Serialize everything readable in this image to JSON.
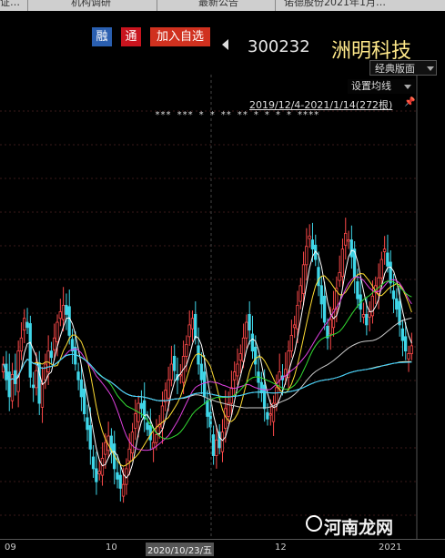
{
  "tabs": [
    "证…",
    "机构调研",
    "最新公告",
    "诺德股份2021年1月…"
  ],
  "header": {
    "badges": [
      {
        "label": "融",
        "color": "#2a5fb0"
      },
      {
        "label": "通",
        "color": "#c8141e"
      },
      {
        "label": "加入自选",
        "color": "#d0311f"
      }
    ],
    "stock_code": "300232",
    "stock_name": "洲明科技"
  },
  "toolbar": {
    "style_label": "经典版面",
    "ma_label": "设置均线",
    "range_label": "2019/12/4-2021/1/14(272根)"
  },
  "markers_text": "***  ***   *    *      **  **        *   *   *   *  ****",
  "x_axis": {
    "labels": [
      "09",
      "10",
      "2020/10/23/五",
      "12",
      "2021"
    ]
  },
  "colors": {
    "up": "#ff4a4a",
    "down": "#3fd6e8",
    "ma5": "#ffffff",
    "ma10": "#ffdd33",
    "ma20": "#e040e0",
    "ma30": "#33dd33",
    "ma60": "#cccccc",
    "ma120": "#ffffcc",
    "ma250": "#33ccff"
  },
  "chart_data": {
    "type": "candlestick",
    "series": [
      {
        "name": "close",
        "values": [
          410,
          398,
          385,
          402,
          395,
          420,
          430,
          445,
          438,
          400,
          392,
          405,
          380,
          395,
          410,
          420,
          415,
          430,
          442,
          450,
          455,
          448,
          432,
          420,
          410,
          398,
          385,
          372,
          360,
          345,
          330,
          320,
          328,
          338,
          350,
          355,
          343,
          330,
          322,
          315,
          318,
          330,
          345,
          358,
          372,
          380,
          376,
          368,
          360,
          352,
          350,
          356,
          364,
          378,
          390,
          398,
          410,
          405,
          398,
          402,
          416,
          425,
          440,
          445,
          430,
          410,
          398,
          385,
          370,
          362,
          340,
          352,
          346,
          358,
          376,
          380,
          392,
          404,
          410,
          418,
          430,
          442,
          436,
          420,
          410,
          396,
          388,
          376,
          368,
          372,
          380,
          392,
          404,
          398,
          406,
          420,
          432,
          440,
          455,
          470,
          486,
          500,
          508,
          498,
          490,
          470,
          456,
          442,
          430,
          444,
          452,
          468,
          480,
          498,
          510,
          505,
          492,
          476,
          460,
          452,
          448,
          440,
          450,
          462,
          470,
          476,
          490,
          498,
          485,
          472,
          460,
          452,
          440,
          428,
          420,
          418,
          424
        ]
      }
    ]
  }
}
